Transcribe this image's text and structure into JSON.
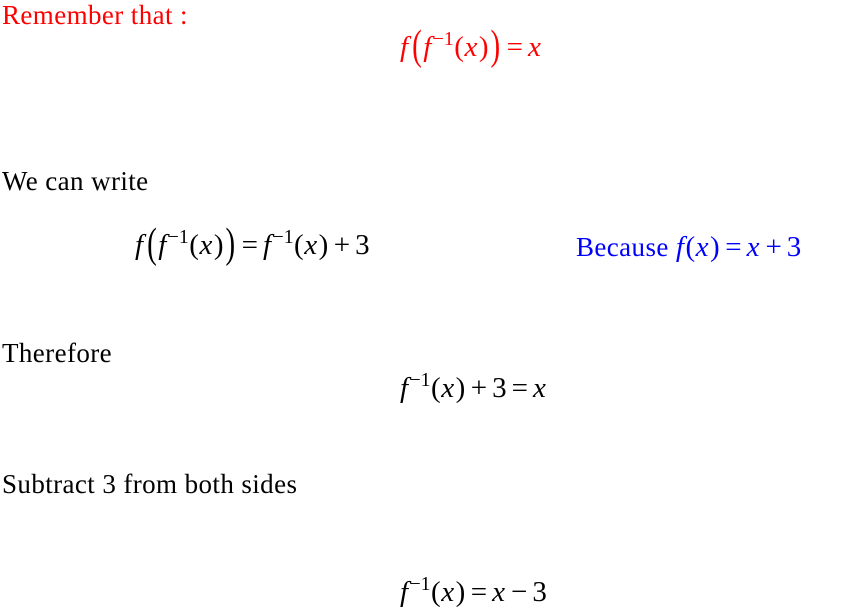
{
  "document": {
    "type": "math-worksheet",
    "topic": "Finding the inverse function of f(x) = x + 3",
    "background_color": "#ffffff",
    "colors": {
      "emphasis_red": "#ff0000",
      "annotation_blue": "#0000ff",
      "body_black": "#000000"
    }
  },
  "lines": {
    "remember_heading": "Remember that :",
    "we_can_write": "We can write",
    "therefore": "Therefore",
    "subtract_instruction": "Subtract 3 from both sides",
    "because_label": "Because"
  },
  "equations": {
    "identity": {
      "plain": "f(f^-1(x)) = x",
      "color": "#ff0000",
      "parts": {
        "f": "f",
        "open_big": "(",
        "inner_f": "f",
        "exponent": "−1",
        "open": "(",
        "var": "x",
        "close": ")",
        "close_big": ")",
        "equals": "=",
        "rhs": "x"
      }
    },
    "substitute": {
      "plain": "f(f^-1(x)) = f^-1(x) + 3",
      "color": "#000000",
      "parts": {
        "f": "f",
        "open_big": "(",
        "inner_f": "f",
        "exponent": "−1",
        "open": "(",
        "var": "x",
        "close": ")",
        "close_big": ")",
        "equals": "=",
        "rhs_f": "f",
        "rhs_exponent": "−1",
        "rhs_open": "(",
        "rhs_var": "x",
        "rhs_close": ")",
        "plus": "+",
        "three": "3"
      }
    },
    "because": {
      "plain": "f(x) = x + 3",
      "color": "#0000ff",
      "parts": {
        "f": "f",
        "open": "(",
        "var": "x",
        "close": ")",
        "equals": "=",
        "rhs_var": "x",
        "plus": "+",
        "three": "3"
      }
    },
    "therefore_eq": {
      "plain": "f^-1(x) + 3 = x",
      "color": "#000000",
      "parts": {
        "f": "f",
        "exponent": "−1",
        "open": "(",
        "var": "x",
        "close": ")",
        "plus": "+",
        "three": "3",
        "equals": "=",
        "rhs": "x"
      }
    },
    "final": {
      "plain": "f^-1(x) = x - 3",
      "color": "#000000",
      "parts": {
        "f": "f",
        "exponent": "−1",
        "open": "(",
        "var": "x",
        "close": ")",
        "equals": "=",
        "rhs_var": "x",
        "minus": "−",
        "three": "3"
      }
    }
  }
}
